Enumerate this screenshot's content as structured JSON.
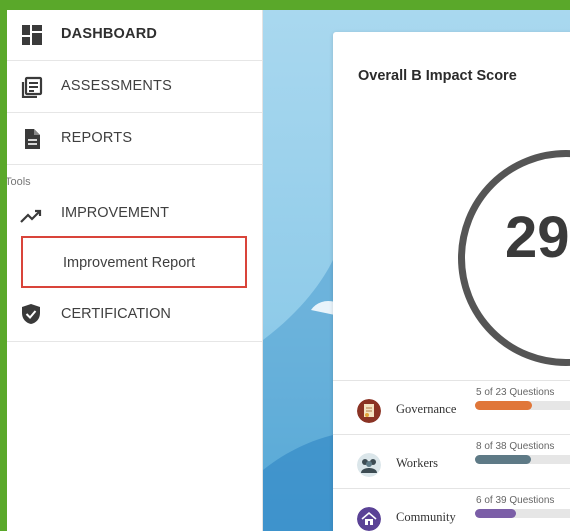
{
  "sidebar": {
    "items": [
      {
        "label": "DASHBOARD",
        "icon": "dashboard-icon"
      },
      {
        "label": "ASSESSMENTS",
        "icon": "assessments-icon"
      },
      {
        "label": "REPORTS",
        "icon": "document-icon"
      }
    ],
    "tools_label": "Tools",
    "improvement": {
      "label": "IMPROVEMENT",
      "icon": "trending-up-icon"
    },
    "improvement_report": {
      "label": "Improvement Report",
      "highlight_color": "#d9443a"
    },
    "certification": {
      "label": "CERTIFICATION",
      "icon": "shield-check-icon"
    }
  },
  "main": {
    "card_title": "Overall B Impact Score",
    "score": "29",
    "categories": [
      {
        "name": "Governance",
        "count_label": "5 of 23 Questions",
        "answered": 5,
        "total": 23,
        "color": "#e0773a",
        "icon": "certificate-icon"
      },
      {
        "name": "Workers",
        "count_label": "8 of 38 Questions",
        "answered": 8,
        "total": 38,
        "color": "#5e7a86",
        "icon": "people-icon"
      },
      {
        "name": "Community",
        "count_label": "6 of 39 Questions",
        "answered": 6,
        "total": 39,
        "color": "#7b5ea7",
        "icon": "house-icon"
      }
    ]
  },
  "colors": {
    "frame_border": "#5aa82a",
    "highlight": "#d9443a"
  }
}
